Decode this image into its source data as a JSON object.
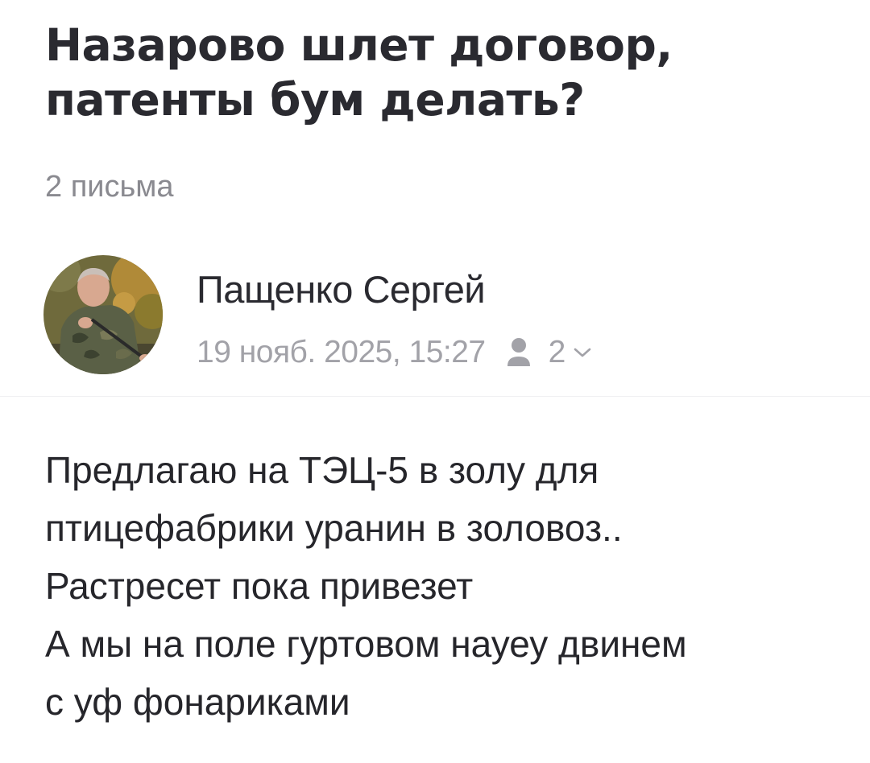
{
  "thread": {
    "title": "Назарово шлет договор, патенты бум делать?",
    "letter_count": "2 письма"
  },
  "message": {
    "sender": "Пащенко Сергей",
    "date": "19 нояб. 2025, 15:27",
    "recipients_count": "2",
    "avatar_icon": "user-photo-avatar",
    "recipients_icon": "person-icon",
    "expand_icon": "chevron-down-icon",
    "body_lines": [
      "Предлагаю на ТЭЦ-5 в золу для",
      "птицефабрики уранин в золовоз..",
      "Растресет пока привезет",
      "А мы на поле гуртовом науеу двинем",
      "с уф фонариками"
    ]
  },
  "colors": {
    "title": "#2a2a30",
    "secondary_text": "#8a8a90",
    "meta_text": "#a2a2a8",
    "body_text": "#26262b",
    "background": "#ffffff"
  }
}
